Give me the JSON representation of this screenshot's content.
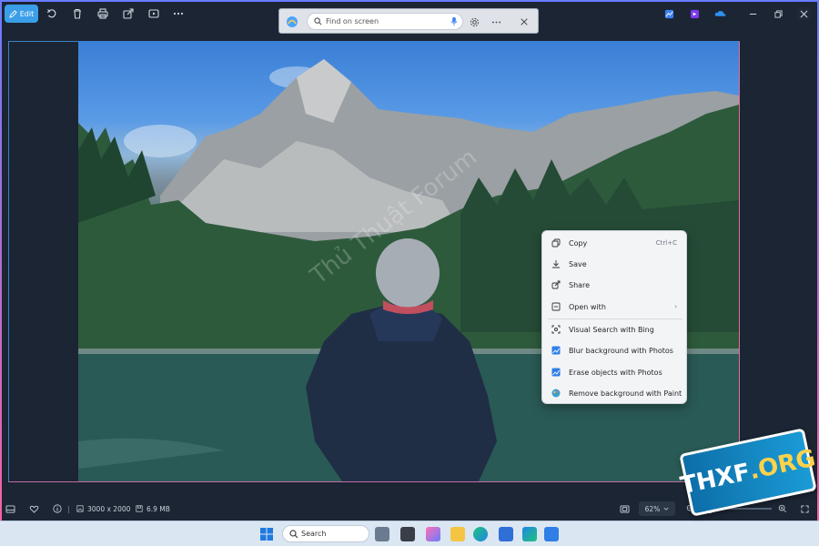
{
  "toolbar": {
    "edit_label": "Edit",
    "icons": [
      "rotate-icon",
      "delete-icon",
      "print-icon",
      "share-icon",
      "slideshow-icon",
      "more-icon"
    ]
  },
  "find_bar": {
    "placeholder": "Find on screen"
  },
  "context_menu": {
    "items": [
      {
        "label": "Copy",
        "shortcut": "Ctrl+C",
        "icon": "copy-icon"
      },
      {
        "label": "Save",
        "shortcut": "",
        "icon": "download-icon"
      },
      {
        "label": "Share",
        "shortcut": "",
        "icon": "share-icon"
      },
      {
        "label": "Open with",
        "shortcut": "",
        "icon": "open-with-icon",
        "has_submenu": true
      },
      {
        "label": "Visual Search with Bing",
        "shortcut": "",
        "icon": "visual-search-icon"
      },
      {
        "label": "Blur background with Photos",
        "shortcut": "",
        "icon": "photos-icon"
      },
      {
        "label": "Erase objects with Photos",
        "shortcut": "",
        "icon": "photos-icon"
      },
      {
        "label": "Remove background with Paint",
        "shortcut": "",
        "icon": "paint-icon"
      }
    ]
  },
  "status": {
    "dimensions": "3000 x 2000",
    "file_size": "6.9 MB",
    "zoom": "62%",
    "zoom_fraction": 0.13
  },
  "taskbar": {
    "search_placeholder": "Search"
  },
  "watermark": "Thủ Thuật Forum",
  "logo": {
    "name": "THXF",
    "suffix": ".ORG"
  },
  "colors": {
    "accent": "#3b9ee8",
    "menu_bg": "#f3f4f6",
    "app_bg": "#1b2533"
  }
}
